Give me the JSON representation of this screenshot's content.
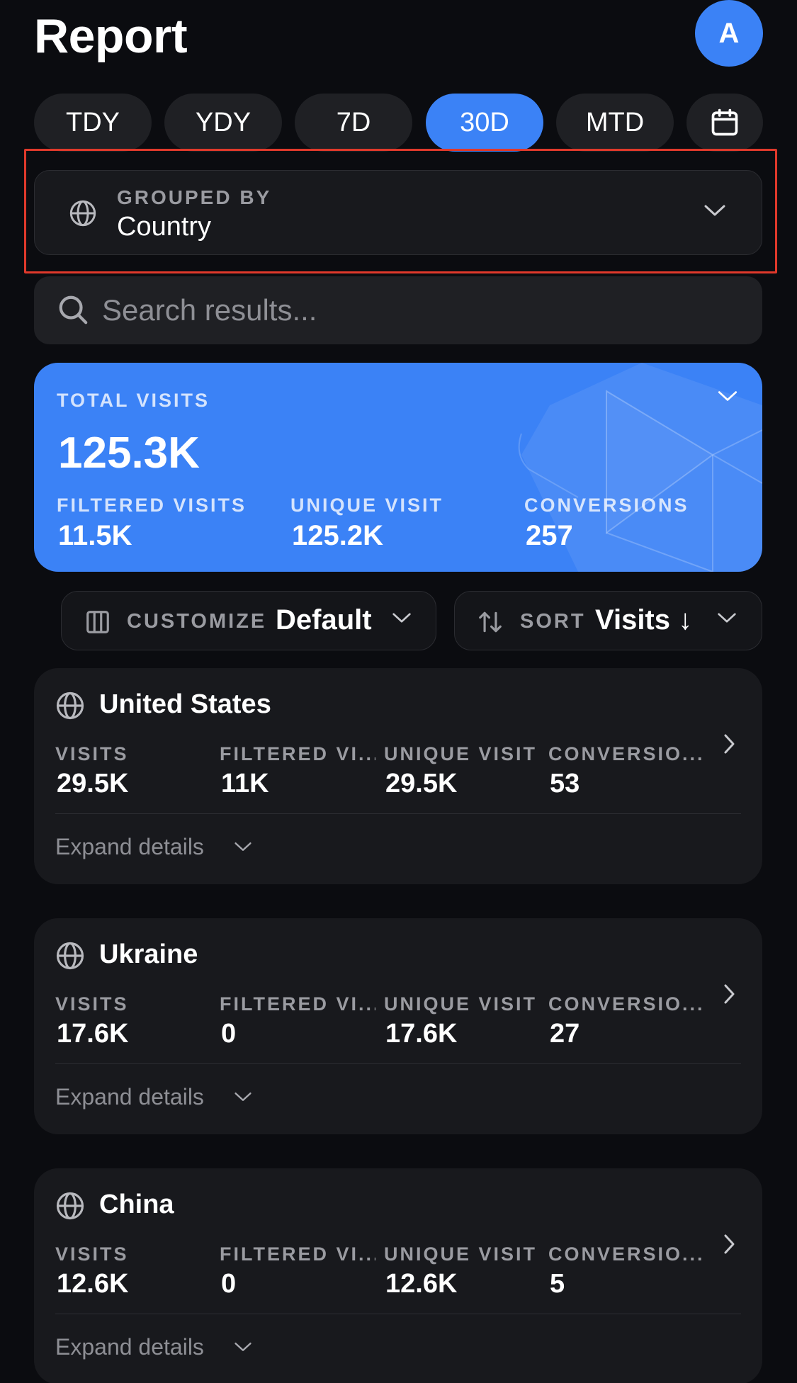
{
  "header": {
    "title": "Report",
    "avatar_initial": "A"
  },
  "tabs": [
    {
      "label": "TDY",
      "active": false
    },
    {
      "label": "YDY",
      "active": false
    },
    {
      "label": "7D",
      "active": false
    },
    {
      "label": "30D",
      "active": true
    },
    {
      "label": "MTD",
      "active": false
    }
  ],
  "grouped_by": {
    "label": "GROUPED BY",
    "value": "Country"
  },
  "search": {
    "placeholder": "Search results..."
  },
  "summary": {
    "total_label": "TOTAL VISITS",
    "total_value": "125.3K",
    "metrics": [
      {
        "label": "FILTERED VISITS",
        "value": "11.5K"
      },
      {
        "label": "UNIQUE VISIT",
        "value": "125.2K"
      },
      {
        "label": "CONVERSIONS",
        "value": "257"
      }
    ]
  },
  "customize": {
    "label": "CUSTOMIZE",
    "value": "Default"
  },
  "sort": {
    "label": "SORT",
    "value": "Visits ↓"
  },
  "metric_labels": [
    "VISITS",
    "FILTERED VI...",
    "UNIQUE VISIT",
    "CONVERSIO..."
  ],
  "countries": [
    {
      "name": "United States",
      "values": [
        "29.5K",
        "11K",
        "29.5K",
        "53"
      ],
      "expand_label": "Expand details"
    },
    {
      "name": "Ukraine",
      "values": [
        "17.6K",
        "0",
        "17.6K",
        "27"
      ],
      "expand_label": "Expand details"
    },
    {
      "name": "China",
      "values": [
        "12.6K",
        "0",
        "12.6K",
        "5"
      ],
      "expand_label": "Expand details"
    }
  ],
  "colors": {
    "accent": "#3b82f6",
    "background": "#0b0c10",
    "card": "#18191d",
    "highlight": "#e0392b"
  }
}
